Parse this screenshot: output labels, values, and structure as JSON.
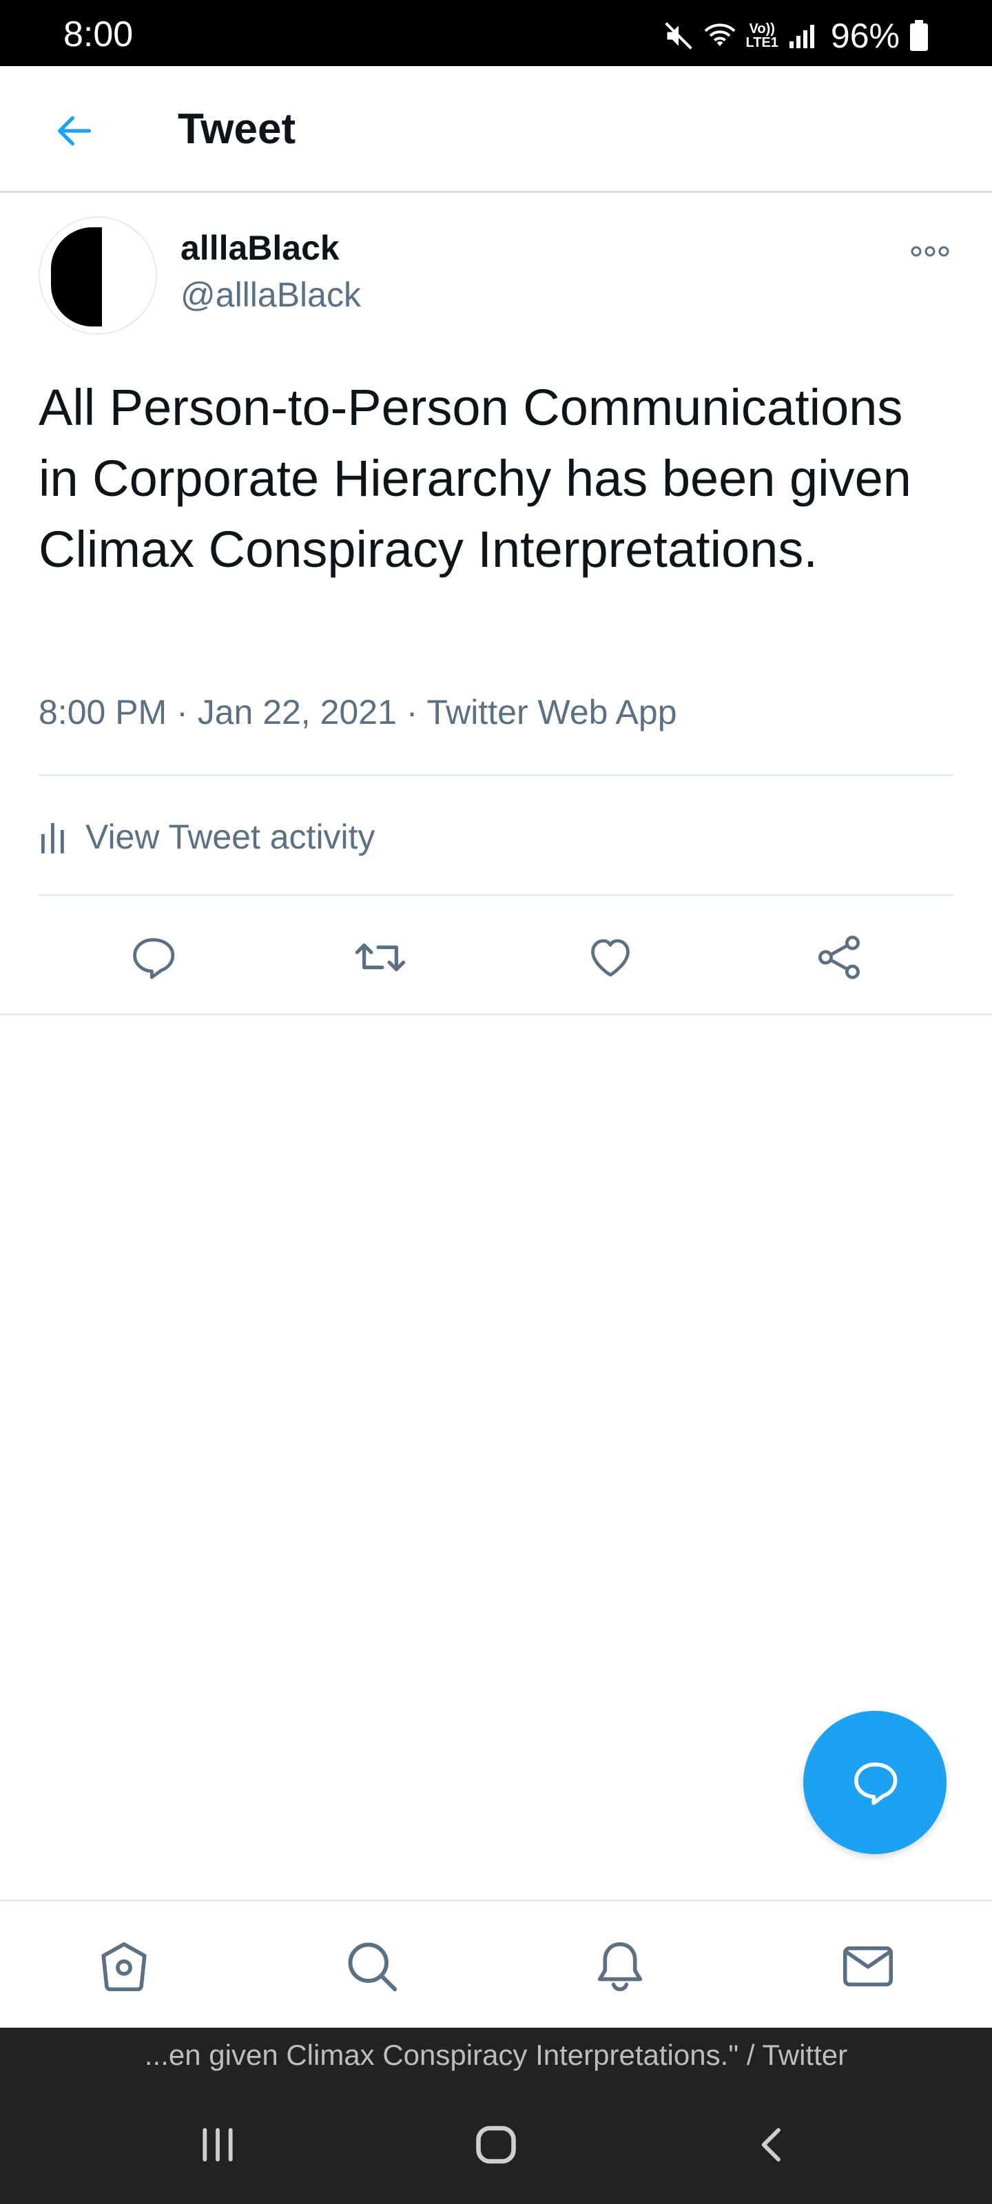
{
  "status_bar": {
    "time": "8:00",
    "lte_label_top": "Vo))",
    "lte_label_bottom": "LTE1",
    "battery": "96%",
    "icons": [
      "mute-icon",
      "wifi-icon",
      "lte-icon",
      "signal-icon",
      "battery-icon"
    ]
  },
  "header": {
    "title": "Tweet",
    "back_icon": "arrow-left-icon"
  },
  "tweet": {
    "display_name": "alllaBlack",
    "handle": "@alllaBlack",
    "text": "All Person-to-Person Communications in Corporate Hierarchy has been given Climax Conspiracy Interpretations.",
    "time": "8:00 PM",
    "date": "Jan 22, 2021",
    "source": "Twitter Web App",
    "separator": "·",
    "activity_label": "View Tweet activity",
    "actions": [
      "reply-icon",
      "retweet-icon",
      "like-icon",
      "share-icon"
    ]
  },
  "bottom_nav": {
    "items": [
      "home-icon",
      "search-icon",
      "notifications-icon",
      "messages-icon"
    ]
  },
  "browser_title": "...en given Climax Conspiracy Interpretations.\" / Twitter",
  "system_nav": [
    "recent-apps-icon",
    "home-button-icon",
    "back-icon"
  ],
  "colors": {
    "accent": "#1da1f2",
    "secondary_text": "#5b7083",
    "divider": "#e6ecf0",
    "icon_gray": "#5b7083"
  }
}
